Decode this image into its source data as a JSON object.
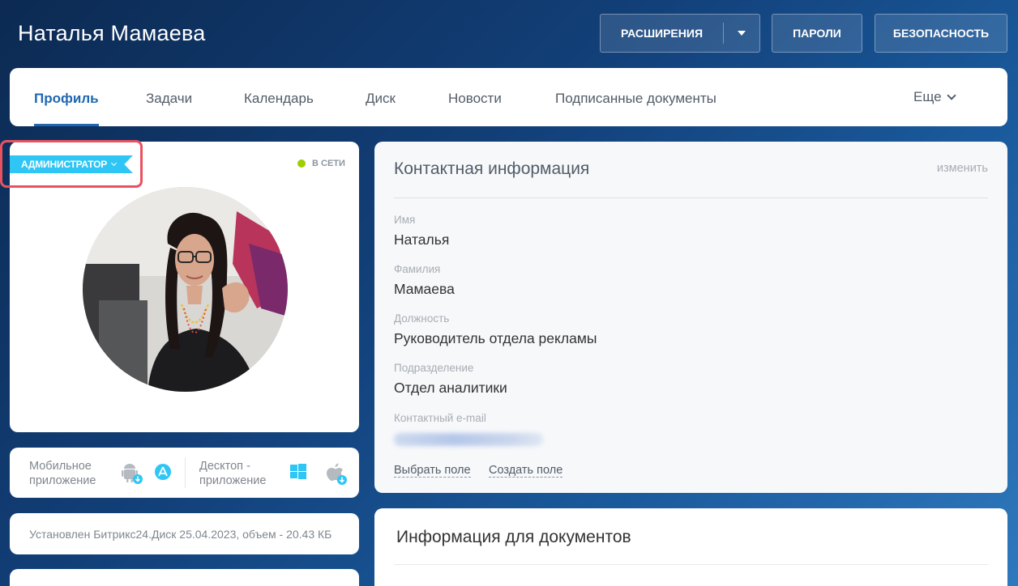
{
  "header": {
    "title": "Наталья Мамаева",
    "buttons": {
      "extensions": "РАСШИРЕНИЯ",
      "passwords": "ПАРОЛИ",
      "security": "БЕЗОПАСНОСТЬ"
    }
  },
  "tabs": [
    {
      "label": "Профиль",
      "active": true
    },
    {
      "label": "Задачи"
    },
    {
      "label": "Календарь"
    },
    {
      "label": "Диск"
    },
    {
      "label": "Новости"
    },
    {
      "label": "Подписанные документы"
    }
  ],
  "more_label": "Еще",
  "profile": {
    "role": "АДМИНИСТРАТОР",
    "status": "В СЕТИ",
    "status_color": "#9dcf00",
    "role_color": "#2fc6f6",
    "highlight_color": "#e8525f"
  },
  "apps": {
    "mobile_line1": "Мобильное",
    "mobile_line2": "приложение",
    "desktop_line1": "Десктоп -",
    "desktop_line2": "приложение",
    "icons": [
      "android-icon",
      "app-store-icon",
      "windows-icon",
      "apple-icon"
    ]
  },
  "disk": {
    "text": "Установлен Битрикс24.Диск 25.04.2023, объем - 20.43 КБ"
  },
  "contact": {
    "title": "Контактная информация",
    "edit_label": "изменить",
    "fields": [
      {
        "label": "Имя",
        "value": "Наталья"
      },
      {
        "label": "Фамилия",
        "value": "Мамаева"
      },
      {
        "label": "Должность",
        "value": "Руководитель отдела рекламы"
      },
      {
        "label": "Подразделение",
        "value": "Отдел аналитики"
      },
      {
        "label": "Контактный e-mail",
        "value": ""
      }
    ],
    "links": {
      "choose_field": "Выбрать поле",
      "create_field": "Создать поле"
    }
  },
  "documents": {
    "title": "Информация для документов"
  },
  "accent": "#2067b0"
}
